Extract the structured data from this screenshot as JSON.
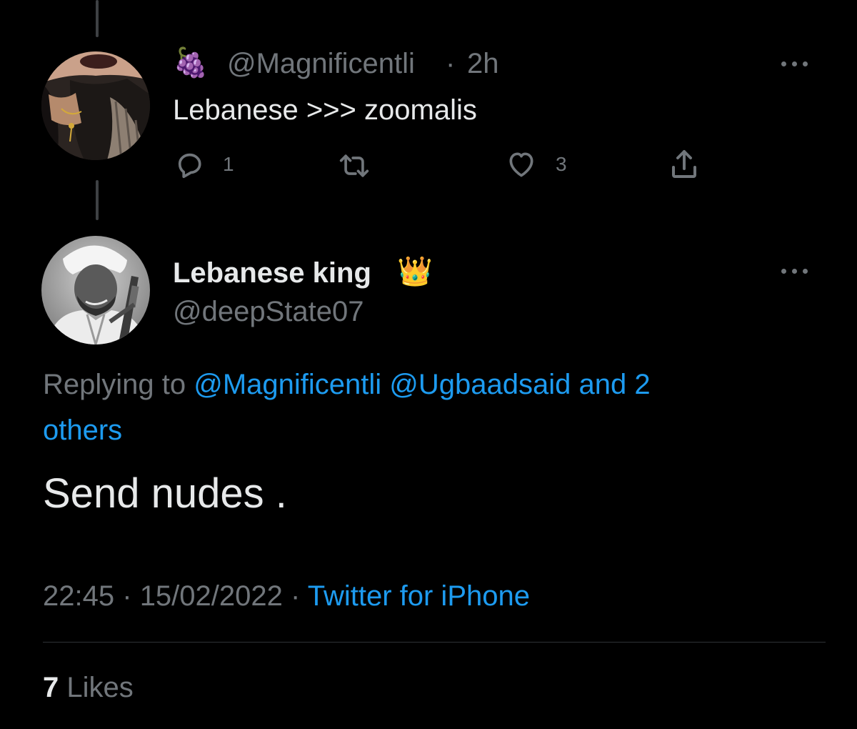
{
  "parent_tweet": {
    "emoji": "🍇",
    "handle": "@Magnificentli",
    "separator": "·",
    "time": "2h",
    "text": "Lebanese >>> zoomalis",
    "reply_count": "1",
    "retweet_count": "",
    "like_count": "3",
    "icons": [
      "reply-icon",
      "retweet-icon",
      "like-icon",
      "share-icon",
      "more-icon"
    ]
  },
  "main_tweet": {
    "display_name": "Lebanese king",
    "name_emoji": "👑",
    "handle": "@deepState07",
    "replying_prefix": "Replying to",
    "replying_targets_line1": "@Magnificentli @Ugbaadsaid and 2",
    "replying_targets_line2": "others",
    "text": "Send nudes .",
    "time": "22:45",
    "separator1": "·",
    "date": "15/02/2022",
    "separator2": "·",
    "source": "Twitter for iPhone",
    "likes_count": "7",
    "likes_label": "Likes"
  },
  "colors": {
    "background": "#000000",
    "text_primary": "#e7e9ea",
    "text_secondary": "#71767b",
    "link_blue": "#1d9bf0",
    "thread_line": "#3e4144",
    "divider": "#2f3336"
  }
}
